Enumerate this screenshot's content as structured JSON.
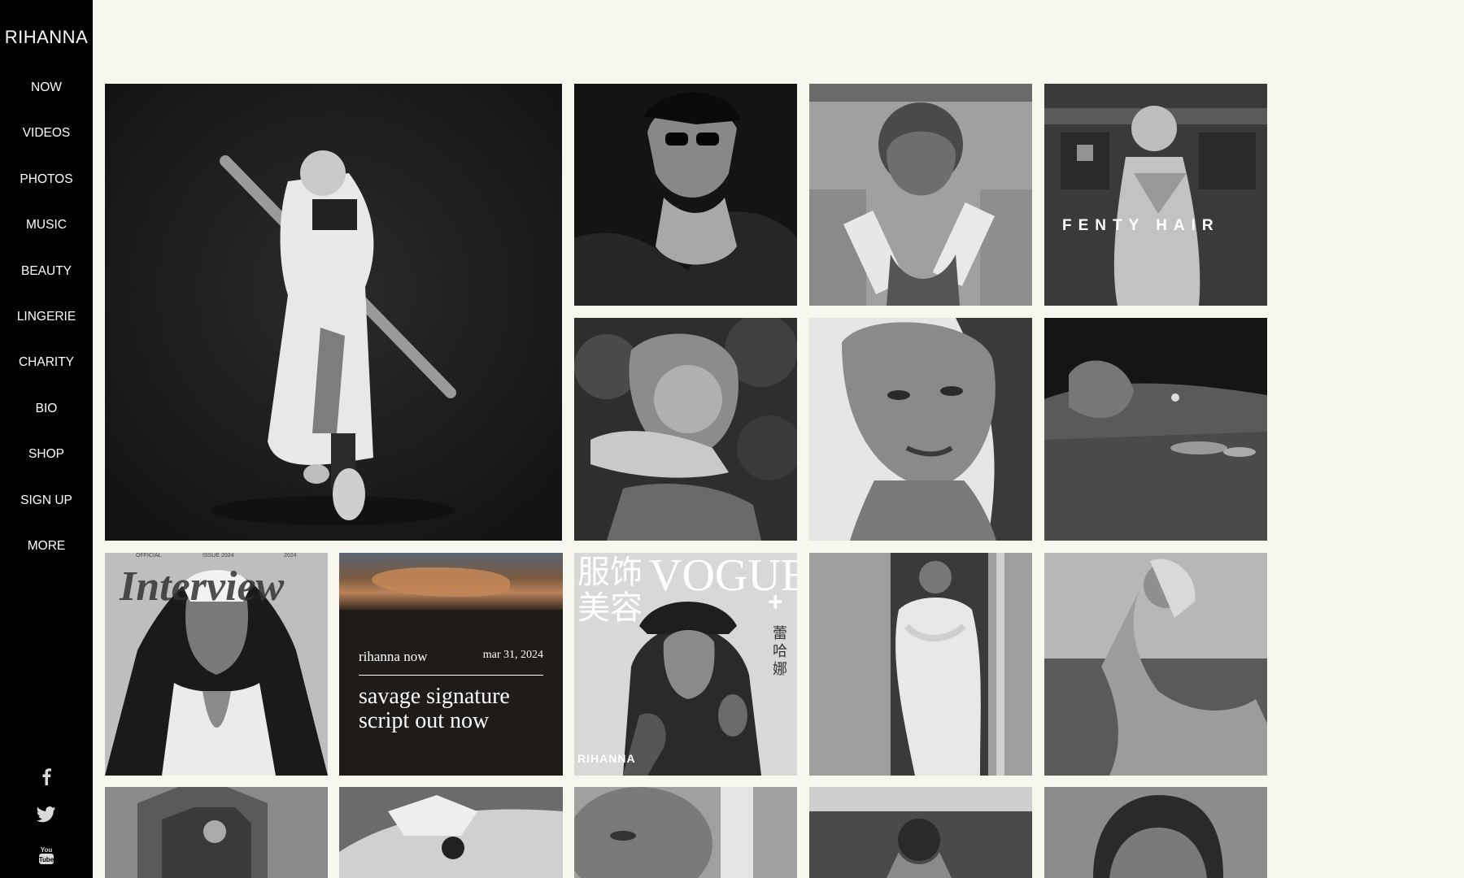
{
  "brand": {
    "logo": "RIHANNA"
  },
  "nav": {
    "items": [
      {
        "label": "NOW"
      },
      {
        "label": "VIDEOS"
      },
      {
        "label": "PHOTOS"
      },
      {
        "label": "MUSIC"
      },
      {
        "label": "BEAUTY"
      },
      {
        "label": "LINGERIE"
      },
      {
        "label": "CHARITY"
      },
      {
        "label": "BIO"
      },
      {
        "label": "SHOP"
      },
      {
        "label": "SIGN UP"
      },
      {
        "label": "MORE"
      }
    ]
  },
  "social": [
    {
      "icon": "facebook-icon"
    },
    {
      "icon": "twitter-icon"
    },
    {
      "icon": "youtube-icon"
    }
  ],
  "tiles": {
    "fenty_hair": "FENTY HAIR",
    "interview_cover": "Interview",
    "vogue_cover_title": "VOGUE",
    "vogue_cover_cjk": "服饰美容",
    "vogue_cover_name": "RIHANNA",
    "vogue_plus": "+",
    "vogue_side_cjk": "蕾哈娜",
    "interview_issue": "OFFICIAL",
    "interview_issue_no": "ISSUE 2024",
    "interview_issue_date": "2024"
  },
  "promo": {
    "label": "rihanna now",
    "date": "mar 31, 2024",
    "headline": "savage signature script out now"
  },
  "colors": {
    "page_bg": "#f7f6ef",
    "sidebar_bg": "#000000",
    "text_light": "#ffffff"
  }
}
